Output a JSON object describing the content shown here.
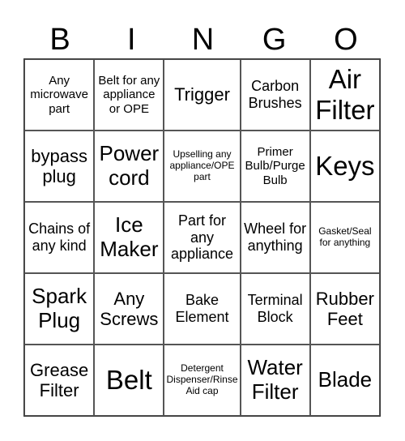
{
  "header": [
    "B",
    "I",
    "N",
    "G",
    "O"
  ],
  "cells": [
    {
      "text": "Any microwave part",
      "size": "s2"
    },
    {
      "text": "Belt for any appliance or OPE",
      "size": "s2"
    },
    {
      "text": "Trigger",
      "size": "s4"
    },
    {
      "text": "Carbon Brushes",
      "size": "s3"
    },
    {
      "text": "Air Filter",
      "size": "s6"
    },
    {
      "text": "bypass plug",
      "size": "s4"
    },
    {
      "text": "Power cord",
      "size": "s5"
    },
    {
      "text": "Upselling any appliance/OPE part",
      "size": "s1"
    },
    {
      "text": "Primer Bulb/Purge Bulb",
      "size": "s2"
    },
    {
      "text": "Keys",
      "size": "s6"
    },
    {
      "text": "Chains of any kind",
      "size": "s3"
    },
    {
      "text": "Ice Maker",
      "size": "s5"
    },
    {
      "text": "Part for any appliance",
      "size": "s3"
    },
    {
      "text": "Wheel for anything",
      "size": "s3"
    },
    {
      "text": "Gasket/Seal for anything",
      "size": "s1"
    },
    {
      "text": "Spark Plug",
      "size": "s5"
    },
    {
      "text": "Any Screws",
      "size": "s4"
    },
    {
      "text": "Bake Element",
      "size": "s3"
    },
    {
      "text": "Terminal Block",
      "size": "s3"
    },
    {
      "text": "Rubber Feet",
      "size": "s4"
    },
    {
      "text": "Grease Filter",
      "size": "s4"
    },
    {
      "text": "Belt",
      "size": "s6"
    },
    {
      "text": "Detergent Dispenser/Rinse Aid cap",
      "size": "s1"
    },
    {
      "text": "Water Filter",
      "size": "s5"
    },
    {
      "text": "Blade",
      "size": "s5"
    }
  ]
}
